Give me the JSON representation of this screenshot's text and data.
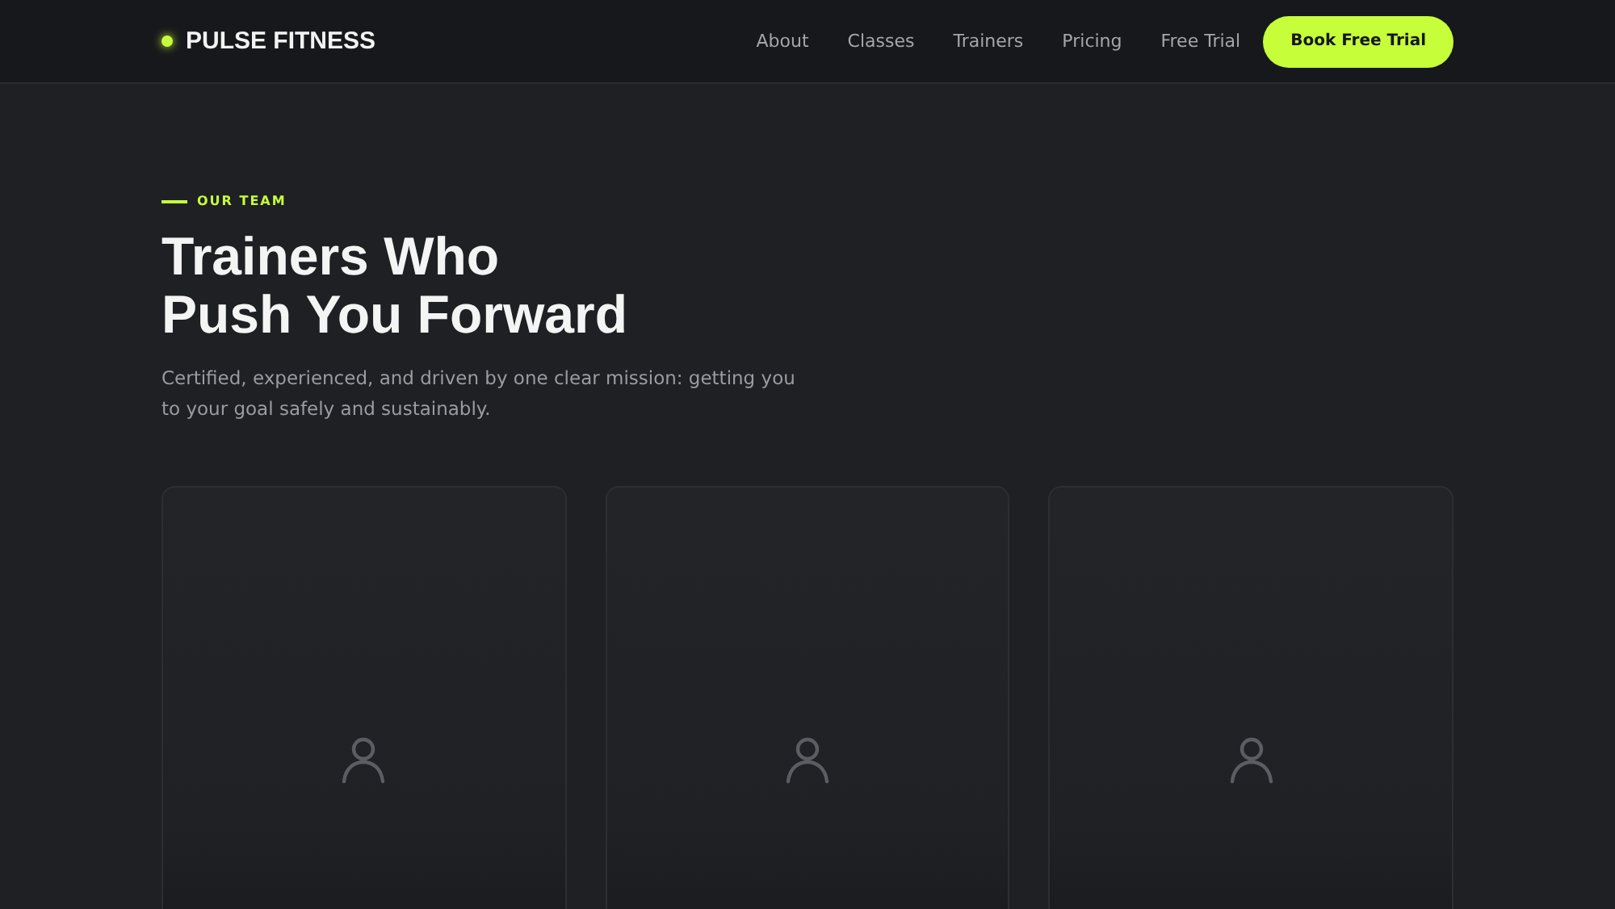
{
  "header": {
    "brand": "PULSE FITNESS",
    "nav": [
      "About",
      "Classes",
      "Trainers",
      "Pricing",
      "Free Trial"
    ],
    "cta": "Book Free Trial"
  },
  "section": {
    "eyebrow": "OUR TEAM",
    "title_lines": [
      "Trainers Who",
      "Push You Forward"
    ],
    "intro": "Certified, experienced, and driven by one clear mission: getting you to your goal safely and sustainably."
  },
  "trainers": [
    {
      "kind": "placeholder"
    },
    {
      "kind": "placeholder"
    },
    {
      "kind": "placeholder"
    }
  ]
}
